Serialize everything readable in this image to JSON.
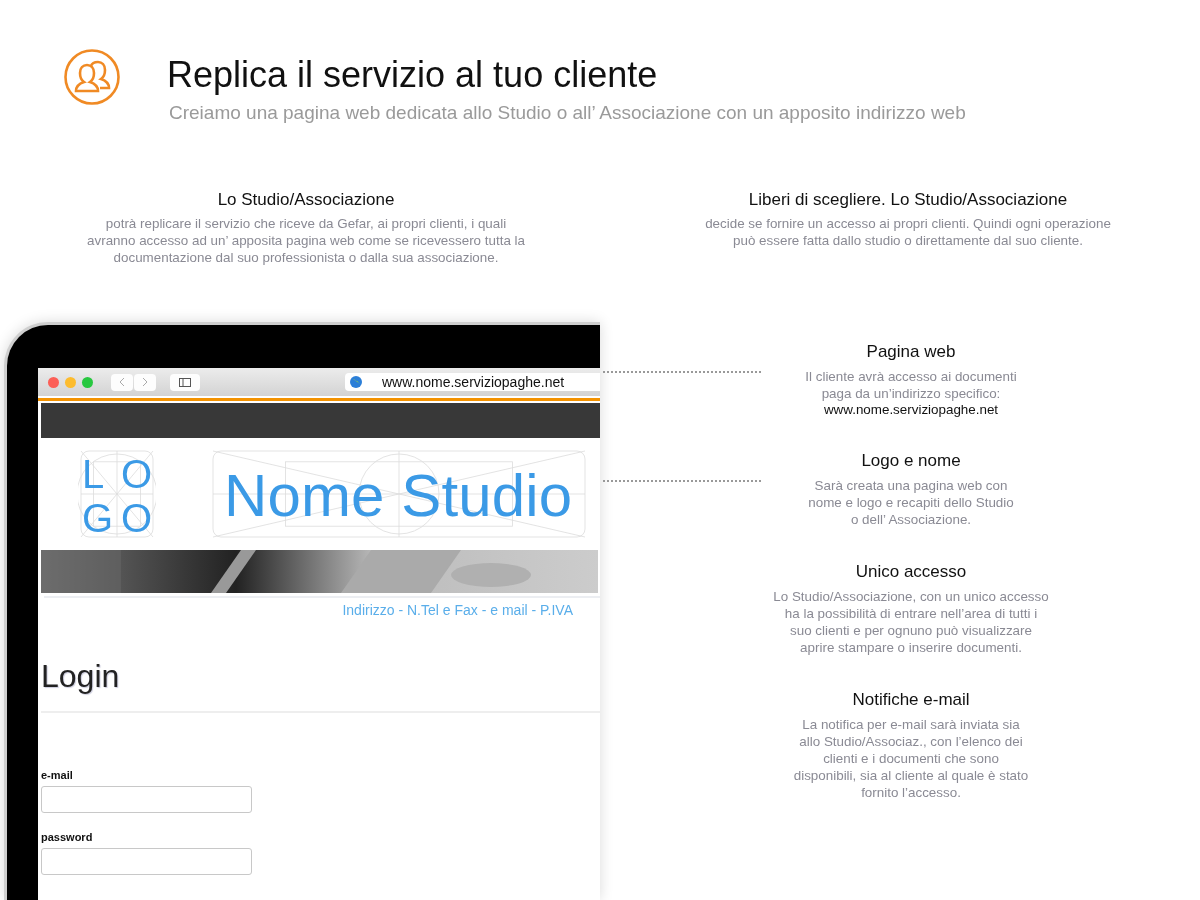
{
  "header": {
    "title": "Replica il servizio al tuo cliente",
    "subtitle": "Creiamo una pagina web dedicata allo Studio o all’ Associazione con un apposito indirizzo web"
  },
  "intro": [
    {
      "title": "Lo Studio/Associazione",
      "text": "potrà replicare il servizio che riceve da Gefar, ai propri clienti, i quali\navranno accesso ad un’ apposita pagina web come se ricevessero  tutta la\ndocumentazione dal suo professionista o dalla sua associazione."
    },
    {
      "title": "Liberi di scegliere. Lo Studio/Associazione",
      "text": "decide se fornire un  accesso ai propri clienti. Quindi ogni operazione\npuò essere fatta dallo studio o direttamente dal suo cliente."
    }
  ],
  "browser": {
    "url": "www.nome.serviziopaghe.net",
    "logo_lines": [
      "LO",
      "GO"
    ],
    "studio_name": "Nome Studio",
    "contacts": "Indirizzo - N.Tel e Fax - e mail - P.IVA",
    "heading": "Login",
    "fields": [
      {
        "label": "e-mail"
      },
      {
        "label": "password"
      }
    ]
  },
  "features": [
    {
      "title": "Pagina web",
      "text": "Il cliente avrà accesso ai documenti\npaga da un’indirizzo specifico:",
      "link": "www.nome.serviziopaghe.net",
      "connected": true
    },
    {
      "title": "Logo e nome",
      "text": "Sarà creata una pagina web con\nnome e logo e recapiti dello Studio\no dell’ Associazione.",
      "connected": true
    },
    {
      "title": "Unico accesso",
      "text": "Lo Studio/Associazione, con un unico accesso\nha la possibilità di entrare nell’area di tutti i\nsuo clienti e per ognuno può visualizzare\naprire stampare o inserire documenti.",
      "connected": false
    },
    {
      "title": "Notifiche e-mail",
      "text": "La notifica per e-mail  sarà inviata sia\nallo Studio/Associaz., con l’elenco dei\nclienti e i documenti che sono\ndisponibili, sia al cliente al quale è stato\nfornito l’accesso.",
      "connected": false
    }
  ]
}
